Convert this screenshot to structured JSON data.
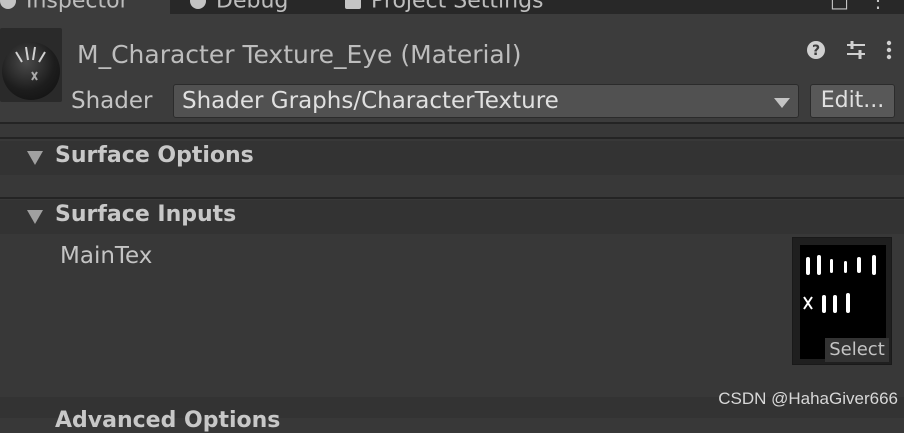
{
  "tabs": [
    {
      "label": "Inspector",
      "icon": "info-icon"
    },
    {
      "label": "Debug",
      "icon": "bug-icon"
    },
    {
      "label": "Project Settings",
      "icon": "gear-icon"
    }
  ],
  "header": {
    "title": "M_Character Texture_Eye (Material)",
    "shader_label": "Shader",
    "shader_value": "Shader Graphs/CharacterTexture",
    "edit_label": "Edit...",
    "icons": [
      "help-icon",
      "preset-icon",
      "more-icon"
    ]
  },
  "sections": [
    {
      "label": "Surface Options"
    },
    {
      "label": "Surface Inputs"
    }
  ],
  "properties": [
    {
      "label": "MainTex",
      "select_label": "Select"
    }
  ],
  "watermark": "CSDN @HahaGiver666",
  "cut_section": "Advanced Options"
}
